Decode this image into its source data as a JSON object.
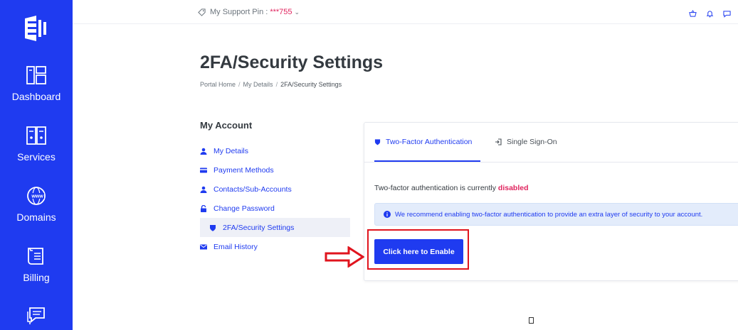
{
  "sidebar": {
    "items": [
      {
        "label": "Dashboard",
        "icon": "dashboard-icon"
      },
      {
        "label": "Services",
        "icon": "services-icon"
      },
      {
        "label": "Domains",
        "icon": "www-globe-icon"
      },
      {
        "label": "Billing",
        "icon": "billing-icon"
      },
      {
        "label": "",
        "icon": "chat-icon"
      }
    ]
  },
  "topbar": {
    "pin_label": "My Support Pin :",
    "pin_value": "***755"
  },
  "page": {
    "title": "2FA/Security Settings",
    "breadcrumb": [
      "Portal Home",
      "My Details",
      "2FA/Security Settings"
    ]
  },
  "account": {
    "title": "My Account",
    "items": [
      {
        "label": "My Details",
        "icon": "user-icon"
      },
      {
        "label": "Payment Methods",
        "icon": "credit-card-icon"
      },
      {
        "label": "Contacts/Sub-Accounts",
        "icon": "user-icon"
      },
      {
        "label": "Change Password",
        "icon": "lock-icon"
      },
      {
        "label": "2FA/Security Settings",
        "icon": "shield-icon",
        "active": true
      },
      {
        "label": "Email History",
        "icon": "envelope-icon"
      }
    ]
  },
  "security": {
    "tabs": [
      {
        "label": "Two-Factor Authentication",
        "icon": "shield-icon",
        "active": true
      },
      {
        "label": "Single Sign-On",
        "icon": "sign-in-icon"
      }
    ],
    "status_prefix": "Two-factor authentication is currently",
    "status_value": "disabled",
    "recommendation": "We recommend enabling two-factor authentication to provide an extra layer of security to your account.",
    "enable_button": "Click here to Enable"
  },
  "colors": {
    "brand": "#1f3bf0",
    "danger": "#e0245e",
    "annotation": "#e0141e"
  }
}
